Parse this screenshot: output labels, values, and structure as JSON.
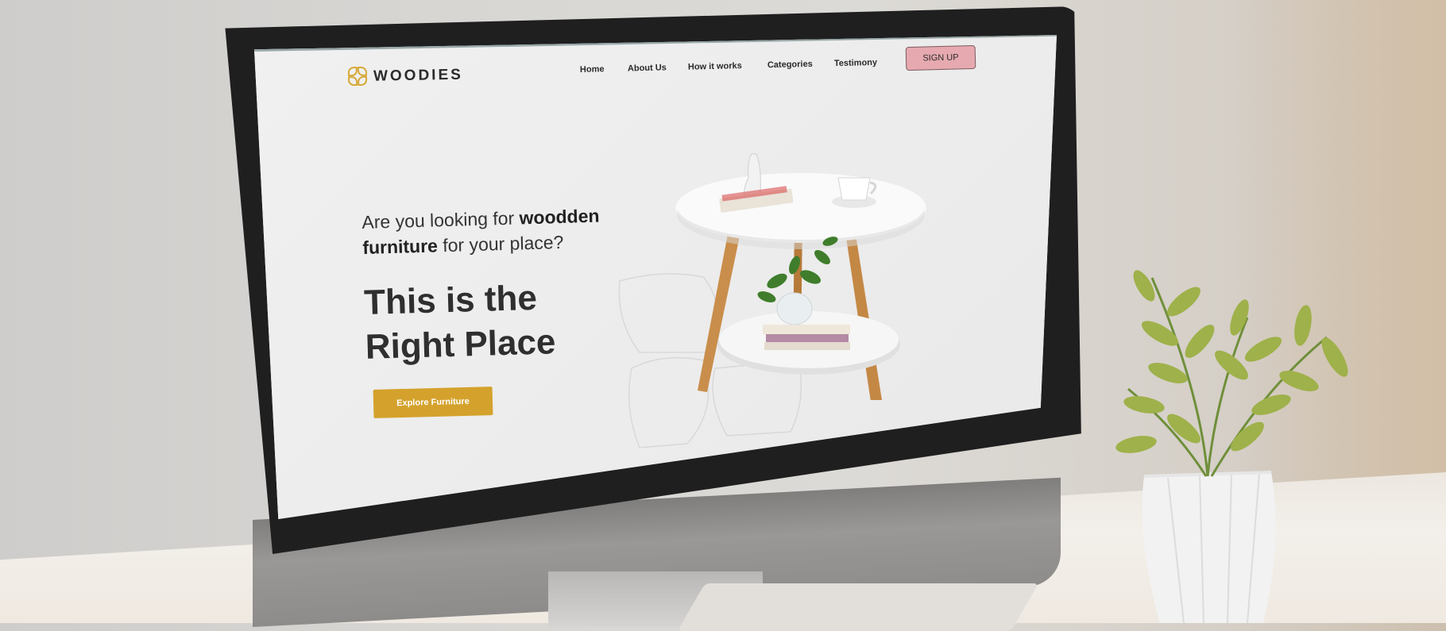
{
  "site": {
    "brand": "WOODIES",
    "nav": [
      "Home",
      "About Us",
      "How it works",
      "Categories",
      "Testimony"
    ],
    "signup_label": "SIGN UP",
    "hero_lead_part1": "Are you looking for ",
    "hero_lead_bold1": "woodden",
    "hero_lead_bold2": "furniture",
    "hero_lead_part2": " for your place?",
    "headline_line1": "This is the",
    "headline_line2": "Right Place",
    "cta_label": "Explore Furniture"
  },
  "colors": {
    "accent": "#d4a22c",
    "signup_bg": "#e6a9b0",
    "screen_bg": "#ececec",
    "bezel": "#1f1f20"
  },
  "icons": {
    "logo": "flower-logo-icon"
  }
}
